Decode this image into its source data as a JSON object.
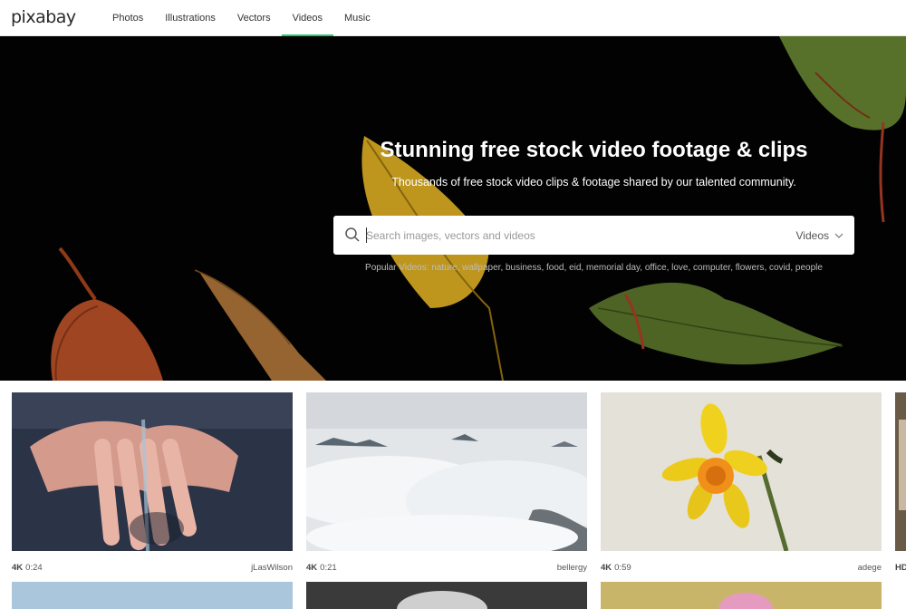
{
  "logo": "pixabay",
  "nav": [
    "Photos",
    "Illustrations",
    "Vectors",
    "Videos",
    "Music"
  ],
  "hero": {
    "title": "Stunning free stock video footage & clips",
    "subtitle": "Thousands of free stock video clips & footage shared by our talented community.",
    "search_placeholder": "Search images, vectors and videos",
    "search_type": "Videos",
    "popular_prefix": "Popular Videos:",
    "popular_tags": [
      "nature",
      "wallpaper",
      "business",
      "food",
      "eid",
      "memorial day",
      "office",
      "love",
      "computer",
      "flowers",
      "covid",
      "people"
    ]
  },
  "videos": [
    {
      "quality": "4K",
      "duration": "0:24",
      "author": "jLasWilson"
    },
    {
      "quality": "4K",
      "duration": "0:21",
      "author": "bellergy"
    },
    {
      "quality": "4K",
      "duration": "0:59",
      "author": "adege"
    },
    {
      "quality": "HD",
      "duration": "",
      "author": ""
    }
  ],
  "colors": {
    "accent": "#2ec66d",
    "hero_bg": "#030303"
  }
}
